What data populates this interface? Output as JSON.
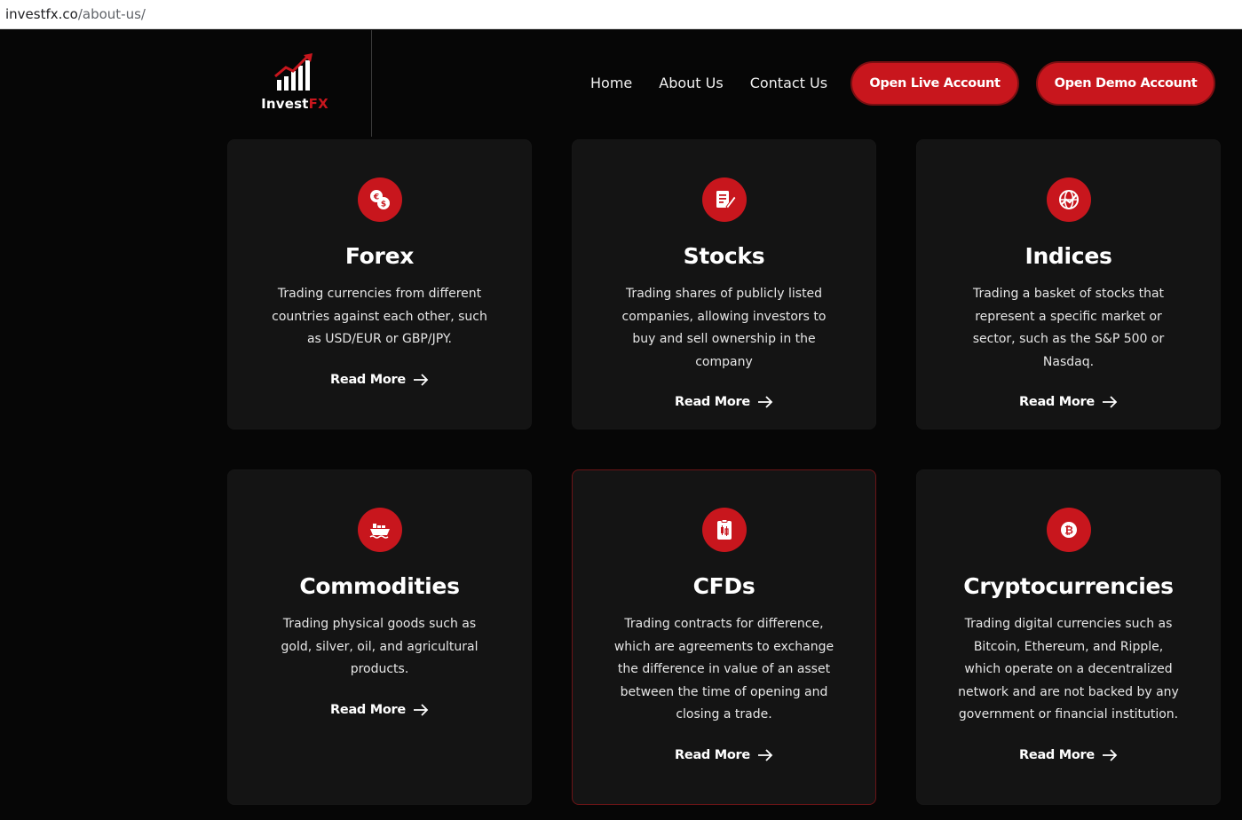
{
  "browser": {
    "url_host": "investfx.co",
    "url_path": "/about-us/"
  },
  "brand": {
    "name_part1": "Invest",
    "name_part2": "FX",
    "accent": "#c8161d"
  },
  "nav": {
    "items": [
      "Home",
      "About Us",
      "Contact Us"
    ]
  },
  "header_buttons": {
    "live": "Open Live Account",
    "demo": "Open Demo Account"
  },
  "cards": [
    {
      "title": "Forex",
      "icon": "currency-exchange-icon",
      "text": "Trading currencies from different countries against each other, such as USD/EUR or GBP/JPY.",
      "link": "Read More"
    },
    {
      "title": "Stocks",
      "icon": "document-pen-icon",
      "text": "Trading shares of publicly listed companies, allowing investors to buy and sell ownership in the company",
      "link": "Read More"
    },
    {
      "title": "Indices",
      "icon": "globe-chart-icon",
      "text": "Trading a basket of stocks that represent a specific market or sector, such as the S&P 500 or Nasdaq.",
      "link": "Read More"
    },
    {
      "title": "Commodities",
      "icon": "cargo-ship-icon",
      "text": "Trading physical goods such as gold, silver, oil, and agricultural products.",
      "link": "Read More"
    },
    {
      "title": "CFDs",
      "icon": "candlestick-clipboard-icon",
      "text": "Trading contracts for difference, which are agreements to exchange the difference in value of an asset between the time of opening and closing a trade.",
      "link": "Read More"
    },
    {
      "title": "Cryptocurrencies",
      "icon": "bitcoin-icon",
      "text": "Trading digital currencies such as Bitcoin, Ethereum, and Ripple, which operate on a decentralized network and are not backed by any government or financial institution.",
      "link": "Read More"
    }
  ]
}
